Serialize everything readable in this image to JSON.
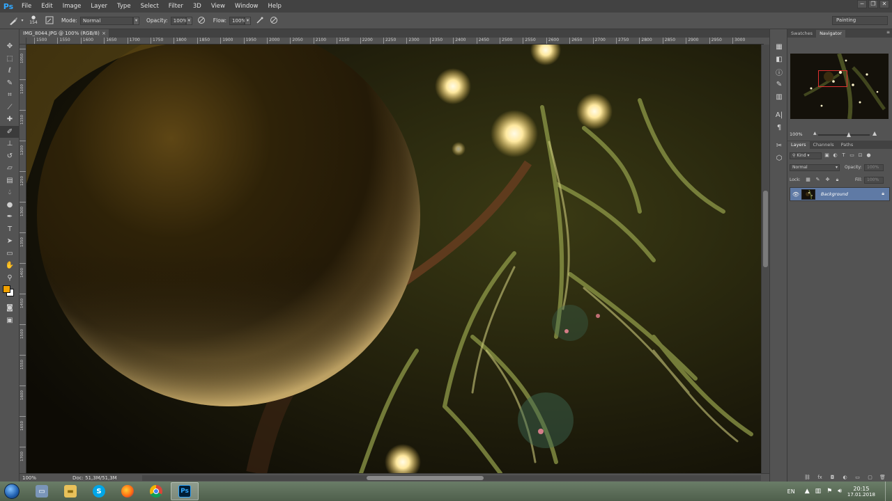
{
  "app": {
    "logo": "Ps"
  },
  "menu": [
    "File",
    "Edit",
    "Image",
    "Layer",
    "Type",
    "Select",
    "Filter",
    "3D",
    "View",
    "Window",
    "Help"
  ],
  "window_controls": {
    "minimize": "─",
    "restore": "❐",
    "close": "✕"
  },
  "options": {
    "brush_size": "154",
    "mode_label": "Mode:",
    "mode_value": "Normal",
    "opacity_label": "Opacity:",
    "opacity_value": "100%",
    "flow_label": "Flow:",
    "flow_value": "100%",
    "workspace": "Painting"
  },
  "document": {
    "tab_title": "IMG_8044.JPG @ 100% (RGB/8)",
    "close_glyph": "×",
    "zoom": "100%",
    "doc_info": "Doc: 51,3M/51,3M"
  },
  "ruler_h": [
    "1500",
    "1550",
    "1600",
    "1650",
    "1700",
    "1750",
    "1800",
    "1850",
    "1900",
    "1950",
    "2000",
    "2050",
    "2100",
    "2150",
    "2200",
    "2250",
    "2300",
    "2350",
    "2400",
    "2450",
    "2500",
    "2550",
    "2600",
    "2650",
    "2700",
    "2750",
    "2800",
    "2850",
    "2900",
    "2950",
    "3000"
  ],
  "ruler_v": [
    "1050",
    "1100",
    "1150",
    "1200",
    "1250",
    "1300",
    "1350",
    "1400",
    "1450",
    "1500",
    "1550",
    "1600",
    "1650",
    "1700"
  ],
  "colors": {
    "foreground": "#f0a000",
    "background": "#ffffff",
    "accent": "#31a8ff",
    "selected_layer": "#5f7aa5"
  },
  "navigator": {
    "tabs": [
      "Swatches",
      "Navigator"
    ],
    "active_tab": "Navigator",
    "zoom": "100%"
  },
  "layers": {
    "tabs": [
      "Layers",
      "Channels",
      "Paths"
    ],
    "active_tab": "Layers",
    "kind_filter": "Kind",
    "blend_mode": "Normal",
    "opacity_label": "Opacity:",
    "opacity_value": "100%",
    "lock_label": "Lock:",
    "fill_label": "Fill:",
    "fill_value": "100%",
    "items": [
      {
        "name": "Background",
        "visible": true,
        "locked": true
      }
    ]
  },
  "taskbar": {
    "apps": [
      "explorer",
      "file-manager",
      "skype",
      "firefox",
      "chrome",
      "photoshop"
    ],
    "active_app": "photoshop",
    "ps_label": "Ps",
    "skype_label": "S",
    "language": "EN",
    "time": "20:15",
    "date": "17.01.2018"
  }
}
